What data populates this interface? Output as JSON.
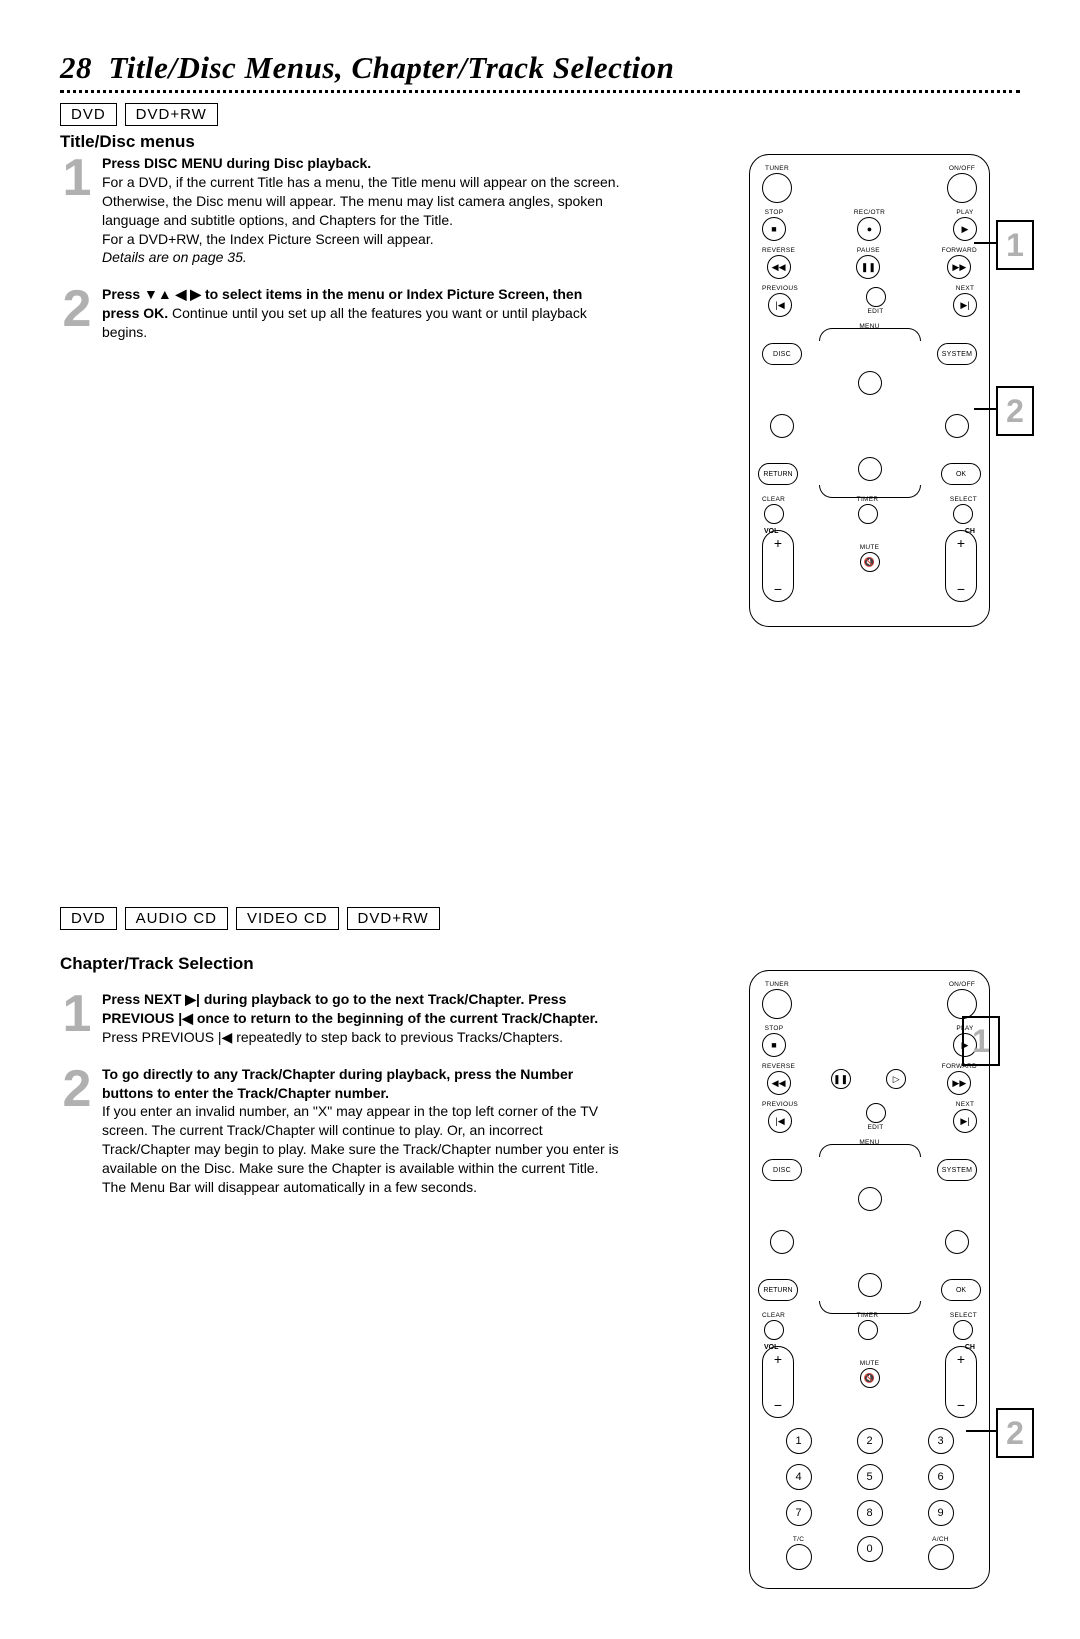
{
  "page_number": "28",
  "page_title": "Title/Disc Menus, Chapter/Track Selection",
  "section1": {
    "tags": [
      "DVD",
      "DVD+RW"
    ],
    "heading": "Title/Disc menus",
    "step1": {
      "num": "1",
      "bold": "Press DISC MENU during Disc playback.",
      "body1": "For a DVD, if the current Title has a menu, the Title menu will appear on the screen. Otherwise, the Disc menu will appear. The menu may list camera angles, spoken language and subtitle options, and Chapters for the Title.",
      "body2": "For a DVD+RW, the Index Picture Screen will appear.",
      "italic": "Details are on page 35."
    },
    "step2": {
      "num": "2",
      "bold1": "Press ▼▲ ◀ ▶ to select items in the menu or Index Picture Screen, then press OK.",
      "body": " Continue until you set up all the features you want or until playback begins."
    }
  },
  "section2": {
    "tags": [
      "DVD",
      "AUDIO CD",
      "VIDEO CD",
      "DVD+RW"
    ],
    "heading": "Chapter/Track Selection",
    "step1": {
      "num": "1",
      "bold": "Press NEXT ▶| during playback to go to the next Track/Chapter. Press PREVIOUS |◀  once to return to the beginning of the current Track/Chapter.",
      "body": " Press PREVIOUS |◀ repeatedly to step back to previous Tracks/Chapters."
    },
    "step2": {
      "num": "2",
      "bold": "To go directly to any Track/Chapter during playback, press the Number buttons to enter the Track/Chapter number.",
      "body": "If you enter an invalid number, an \"X\" may appear in the top left corner of the TV screen. The current Track/Chapter will continue to play. Or, an incorrect Track/Chapter may begin to play. Make sure the Track/Chapter number you enter is available on the Disc. Make sure the Chapter is available within the current Title. The Menu Bar will disappear automatically in a few seconds."
    }
  },
  "remote": {
    "tuner": "TUNER",
    "onoff": "ON/OFF",
    "stop": "STOP",
    "recotr": "REC/OTR",
    "play": "PLAY",
    "reverse": "REVERSE",
    "pause": "PAUSE",
    "forward": "FORWARD",
    "previous": "PREVIOUS",
    "edit": "EDIT",
    "next": "NEXT",
    "menu": "MENU",
    "disc": "DISC",
    "system": "SYSTEM",
    "return": "RETURN",
    "ok": "OK",
    "clear": "CLEAR",
    "timer": "TIMER",
    "select": "SELECT",
    "vol": "VOL",
    "ch": "CH",
    "mute": "MUTE",
    "tc": "T/C",
    "ach": "A/CH",
    "n1": "1",
    "n2": "2",
    "n3": "3",
    "n4": "4",
    "n5": "5",
    "n6": "6",
    "n7": "7",
    "n8": "8",
    "n9": "9",
    "n0": "0",
    "callout1": "1",
    "callout2": "2"
  }
}
